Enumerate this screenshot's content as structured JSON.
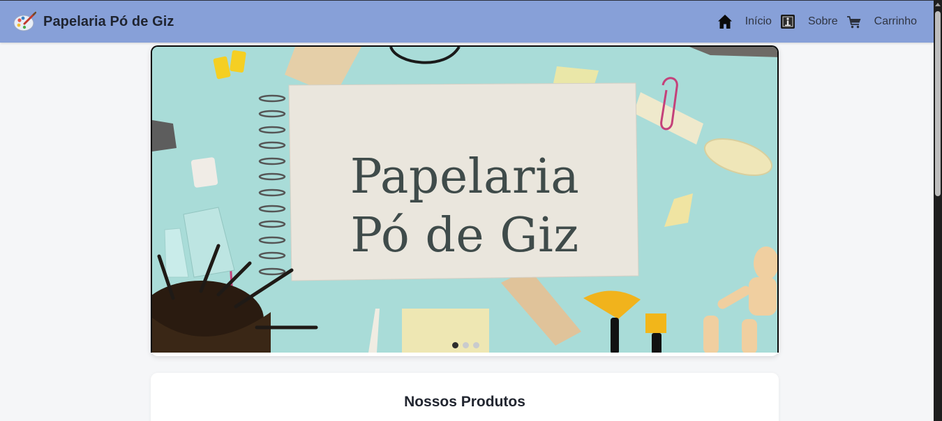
{
  "brand": {
    "name": "Papelaria Pó de Giz",
    "logo_icon": "palette-brush-icon"
  },
  "nav": {
    "items": [
      {
        "label": "Início",
        "icon": "home-icon"
      },
      {
        "label": "Sobre",
        "icon": "info-icon"
      },
      {
        "label": "Carrinho",
        "icon": "cart-icon"
      }
    ]
  },
  "carousel": {
    "slide_title_line1": "Papelaria",
    "slide_title_line2": "Pó de Giz",
    "slide_count": 3,
    "active_slide": 1
  },
  "products": {
    "title": "Nossos Produtos"
  },
  "colors": {
    "navbar": "#87a0d8",
    "page_bg": "#f5f6f8",
    "hero_bg": "#a9dcd8",
    "hero_text": "#3f4b4a"
  }
}
